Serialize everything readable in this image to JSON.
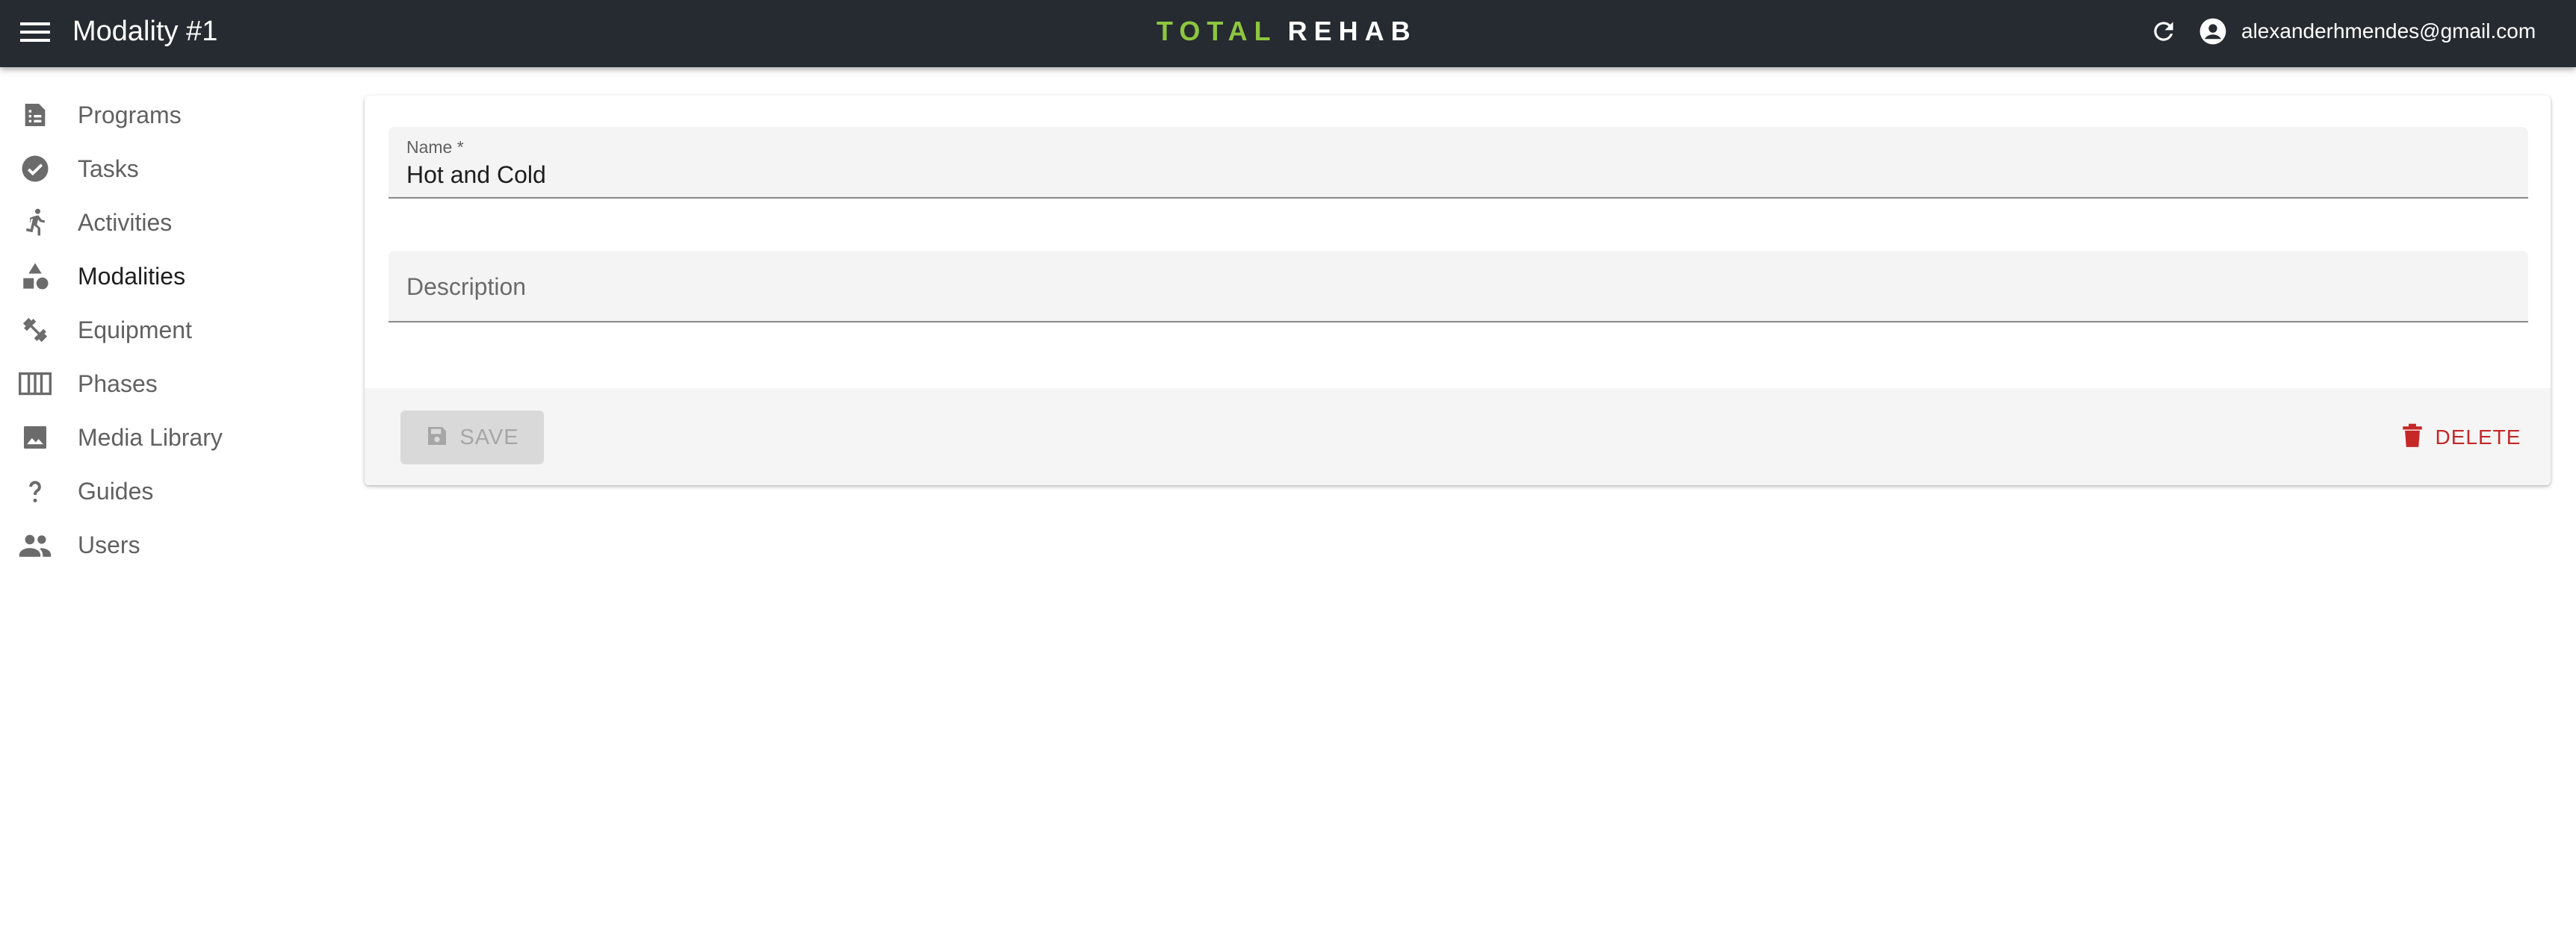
{
  "header": {
    "page_title": "Modality #1",
    "logo_part1": "TOTAL",
    "logo_part2": "REHAB",
    "user_email": "alexanderhmendes@gmail.com"
  },
  "sidebar": {
    "items": [
      {
        "label": "Programs",
        "icon": "program-icon"
      },
      {
        "label": "Tasks",
        "icon": "check-circle-icon"
      },
      {
        "label": "Activities",
        "icon": "running-person-icon"
      },
      {
        "label": "Modalities",
        "icon": "shapes-icon",
        "active": true
      },
      {
        "label": "Equipment",
        "icon": "dumbbell-icon"
      },
      {
        "label": "Phases",
        "icon": "columns-icon"
      },
      {
        "label": "Media Library",
        "icon": "image-icon"
      },
      {
        "label": "Guides",
        "icon": "question-mark-icon"
      },
      {
        "label": "Users",
        "icon": "people-icon"
      }
    ]
  },
  "form": {
    "name_label": "Name *",
    "name_value": "Hot and Cold",
    "description_label": "Description",
    "description_value": ""
  },
  "actions": {
    "save_label": "SAVE",
    "delete_label": "DELETE"
  },
  "colors": {
    "topbar": "#262b31",
    "logo_accent": "#8dc63f",
    "delete": "#c62828"
  }
}
